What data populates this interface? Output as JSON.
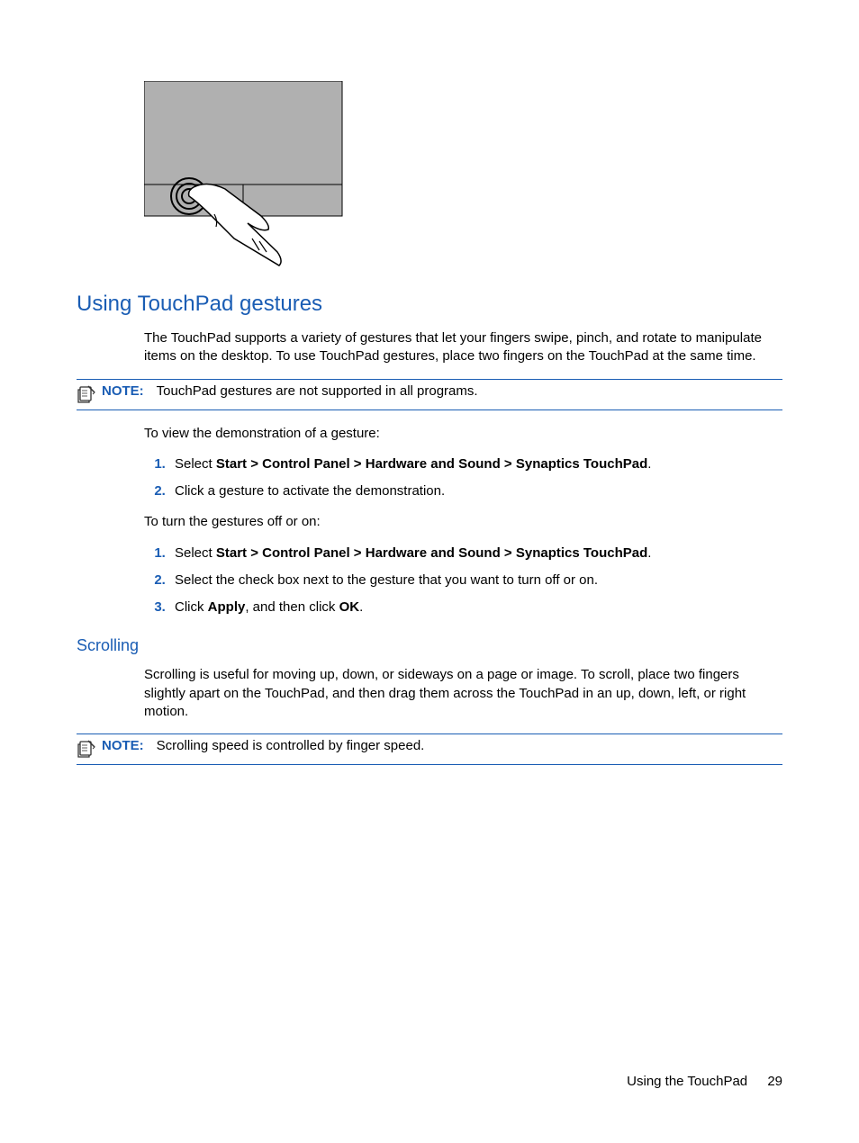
{
  "figure_alt": "TouchPad with finger tapping the left button area",
  "heading_gestures": "Using TouchPad gestures",
  "intro_text": "The TouchPad supports a variety of gestures that let your fingers swipe, pinch, and rotate to manipulate items on the desktop. To use TouchPad gestures, place two fingers on the TouchPad at the same time.",
  "note1_label": "NOTE:",
  "note1_text": "TouchPad gestures are not supported in all programs.",
  "view_demo_text": "To view the demonstration of a gesture:",
  "steps_view": {
    "s1_pre": "Select ",
    "s1_bold": "Start > Control Panel > Hardware and Sound > Synaptics TouchPad",
    "s1_post": ".",
    "s2": "Click a gesture to activate the demonstration."
  },
  "toggle_text": "To turn the gestures off or on:",
  "steps_toggle": {
    "s1_pre": "Select ",
    "s1_bold": "Start > Control Panel > Hardware and Sound > Synaptics TouchPad",
    "s1_post": ".",
    "s2": "Select the check box next to the gesture that you want to turn off or on.",
    "s3_pre": "Click ",
    "s3_b1": "Apply",
    "s3_mid": ", and then click ",
    "s3_b2": "OK",
    "s3_post": "."
  },
  "heading_scrolling": "Scrolling",
  "scrolling_text": "Scrolling is useful for moving up, down, or sideways on a page or image. To scroll, place two fingers slightly apart on the TouchPad, and then drag them across the TouchPad in an up, down, left, or right motion.",
  "note2_label": "NOTE:",
  "note2_text": "Scrolling speed is controlled by finger speed.",
  "footer_section": "Using the TouchPad",
  "footer_page": "29"
}
